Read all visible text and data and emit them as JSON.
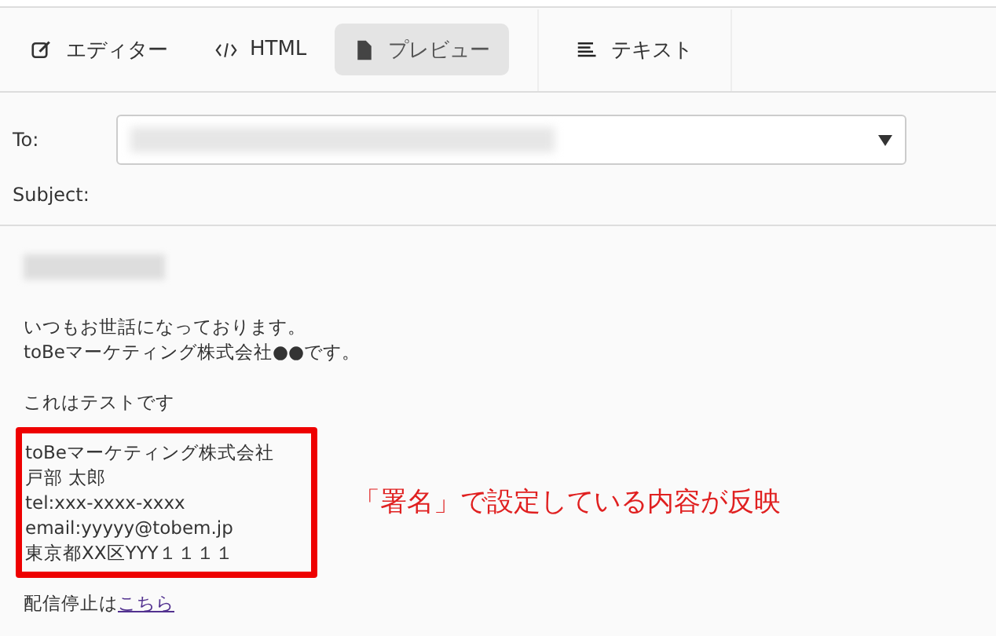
{
  "toolbar": {
    "tabs": [
      {
        "label": "エディター",
        "kind": "editor",
        "selected": false
      },
      {
        "label": "HTML",
        "kind": "code",
        "selected": false
      },
      {
        "label": "プレビュー",
        "kind": "document",
        "selected": true
      },
      {
        "label": "テキスト",
        "kind": "text",
        "selected": false
      }
    ]
  },
  "header": {
    "to_label": "To:",
    "subject_label": "Subject:"
  },
  "body": {
    "greeting": [
      "いつもお世話になっております。",
      "toBeマーケティング株式会社●●です。"
    ],
    "message": "これはテストです",
    "signature": [
      "toBeマーケティング株式会社",
      "戸部 太郎",
      "tel:xxx-xxxx-xxxx",
      "email:yyyyy@tobem.jp",
      "東京都XX区YYY１１１１"
    ],
    "annotation": "「署名」で設定している内容が反映",
    "unsubscribe": {
      "text": "配信停止は",
      "link": "こちら"
    }
  }
}
